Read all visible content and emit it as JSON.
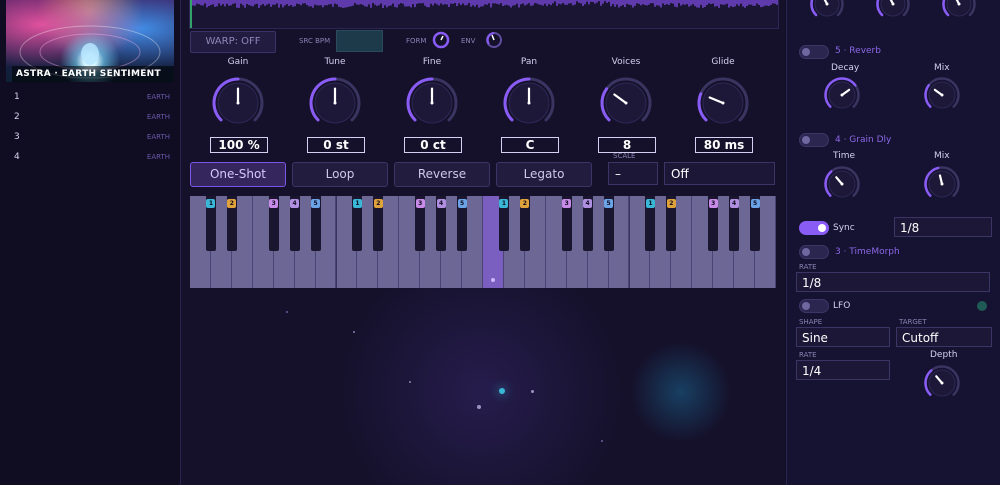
{
  "sidebar": {
    "art_title": "ASTRA · EARTH SENTIMENT",
    "tracks": [
      {
        "num": "1",
        "tag": "EARTH"
      },
      {
        "num": "2",
        "tag": "EARTH"
      },
      {
        "num": "3",
        "tag": "EARTH"
      },
      {
        "num": "4",
        "tag": "EARTH"
      }
    ]
  },
  "toolbar": {
    "warp_label": "WARP: OFF",
    "src_bpm_label": "SRC BPM",
    "src_bpm_value": "",
    "form_label": "FORM",
    "env_label": "ENV"
  },
  "knobs": [
    {
      "label": "Gain",
      "value": "100 %",
      "level": 0.5
    },
    {
      "label": "Tune",
      "value": "0 st",
      "level": 0.5
    },
    {
      "label": "Fine",
      "value": "0 ct",
      "level": 0.5
    },
    {
      "label": "Pan",
      "value": "C",
      "level": 0.5
    },
    {
      "label": "Voices",
      "value": "8",
      "level": 0.3
    },
    {
      "label": "Glide",
      "value": "80 ms",
      "level": 0.25
    }
  ],
  "modes": [
    {
      "label": "One-Shot",
      "active": true
    },
    {
      "label": "Loop",
      "active": false
    },
    {
      "label": "Reverse",
      "active": false
    },
    {
      "label": "Legato",
      "active": false
    }
  ],
  "scale": {
    "label": "SCALE",
    "value": "–",
    "off_value": "Off"
  },
  "keyboard": {
    "badges": [
      "1",
      "2",
      "3",
      "4",
      "5"
    ],
    "colors": {
      "1": "#3ab7d6",
      "2": "#e0a23a",
      "3": "#c98be8",
      "4": "#b08fe0",
      "5": "#6aa3e6"
    }
  },
  "right": {
    "reverb": {
      "title": "5 · Reverb",
      "decay_label": "Decay",
      "mix_label": "Mix",
      "decay_level": 0.7,
      "mix_level": 0.3
    },
    "grain": {
      "title": "4 · Grain Dly",
      "time_label": "Time",
      "mix_label": "Mix",
      "time_level": 0.35,
      "mix_level": 0.45
    },
    "sync": {
      "label": "Sync",
      "value": "1/8"
    },
    "timemorph": {
      "title": "3 · TimeMorph",
      "rate_label": "RATE",
      "rate_value": "1/8"
    },
    "lfo": {
      "label": "LFO",
      "shape_label": "SHAPE",
      "shape_value": "Sine",
      "target_label": "TARGET",
      "target_value": "Cutoff",
      "rate_label": "RATE",
      "rate_value": "1/4",
      "depth_label": "Depth",
      "depth_level": 0.35
    }
  },
  "colors": {
    "accent": "#8a5cf6",
    "knob_track": "#3a3460",
    "teal": "#3ab7d6"
  }
}
